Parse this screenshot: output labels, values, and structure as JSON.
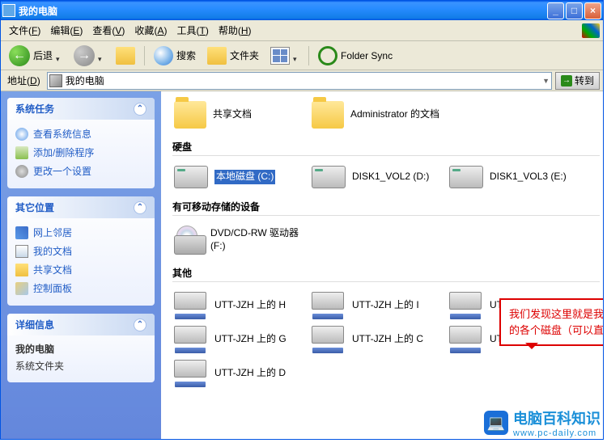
{
  "window": {
    "title": "我的电脑"
  },
  "menu": {
    "file": "文件",
    "file_u": "F",
    "edit": "编辑",
    "edit_u": "E",
    "view": "查看",
    "view_u": "V",
    "fav": "收藏",
    "fav_u": "A",
    "tools": "工具",
    "tools_u": "T",
    "help": "帮助",
    "help_u": "H"
  },
  "toolbar": {
    "back": "后退",
    "search": "搜索",
    "folders": "文件夹",
    "sync": "Folder Sync"
  },
  "address": {
    "label": "地址",
    "label_u": "D",
    "value": "我的电脑",
    "go": "转到"
  },
  "panels": {
    "systasks": {
      "title": "系统任务",
      "items": [
        "查看系统信息",
        "添加/删除程序",
        "更改一个设置"
      ]
    },
    "other": {
      "title": "其它位置",
      "items": [
        "网上邻居",
        "我的文档",
        "共享文档",
        "控制面板"
      ]
    },
    "details": {
      "title": "详细信息",
      "name": "我的电脑",
      "type": "系统文件夹"
    }
  },
  "sections": {
    "files": {
      "items": [
        "共享文档",
        "Administrator 的文档"
      ]
    },
    "drives": {
      "title": "硬盘",
      "items": [
        "本地磁盘 (C:)",
        "DISK1_VOL2 (D:)",
        "DISK1_VOL3 (E:)"
      ]
    },
    "removable": {
      "title": "有可移动存储的设备",
      "items": [
        "DVD/CD-RW 驱动器 (F:)"
      ]
    },
    "other": {
      "title": "其他",
      "items": [
        "UTT-JZH 上的 H",
        "UTT-JZH 上的 I",
        "UTT-JZH 上的 F",
        "UTT-JZH 上的 G",
        "UTT-JZH 上的 C",
        "UTT-JZH 上的 E",
        "UTT-JZH 上的 D"
      ]
    }
  },
  "callout": "我们发现这里就是我本地电脑的各个磁盘（可以直接打开的）",
  "watermark": {
    "brand": "电脑百科知识",
    "url": "www.pc-daily.com"
  }
}
